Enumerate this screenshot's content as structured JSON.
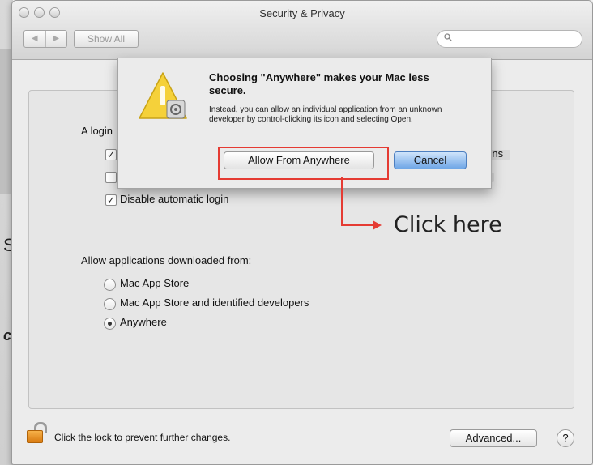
{
  "window": {
    "title": "Security & Privacy",
    "nav_back": "◀",
    "nav_forward": "▶",
    "show_all": "Show All",
    "search_placeholder": ""
  },
  "panel": {
    "login_label": "A login",
    "row1_suffix": "egins",
    "disable_auto_login": "Disable automatic login",
    "allow_heading": "Allow applications downloaded from:",
    "options": [
      "Mac App Store",
      "Mac App Store and identified developers",
      "Anywhere"
    ],
    "selected_option": "Anywhere"
  },
  "footer": {
    "lock_text": "Click the lock to prevent further changes.",
    "advanced_button": "Advanced...",
    "help_button": "?"
  },
  "dialog": {
    "title": "Choosing \"Anywhere\" makes your Mac less secure.",
    "message": "Instead, you can allow an individual application from an unknown developer by control-clicking its icon and selecting Open.",
    "allow_button": "Allow From Anywhere",
    "cancel_button": "Cancel"
  },
  "annotation": {
    "label": "Click here",
    "color": "#e53b33"
  },
  "background_window": {
    "letter_s": "S",
    "letter_c": "c"
  }
}
